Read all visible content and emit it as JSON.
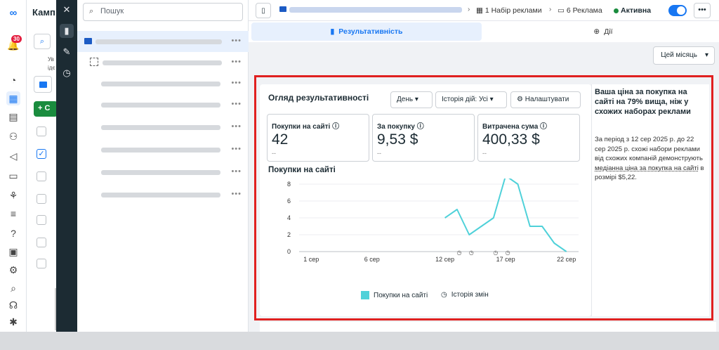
{
  "sidebar": {
    "notification_count": "30",
    "icons": [
      "meta-logo-icon",
      "notifications-icon",
      "dashboard-icon",
      "table-icon",
      "pages-icon",
      "audience-icon",
      "megaphone-icon",
      "billing-icon",
      "network-icon",
      "menu-icon",
      "help-icon",
      "news-icon",
      "settings-icon",
      "search-icon",
      "support-icon",
      "bug-icon"
    ]
  },
  "campaign_panel": {
    "title": "Камп",
    "create_label": "+ С",
    "truncated_text_1": "Ув",
    "truncated_text_2": "ідє"
  },
  "tree": {
    "search_placeholder": "Пошук",
    "row_menu": "•••"
  },
  "topbar": {
    "adset_crumb": "1 Набір реклами",
    "ad_crumb": "6 Реклама",
    "status": "Активна",
    "more": "•••"
  },
  "tabs": {
    "performance": "Результативність",
    "actions": "Дії"
  },
  "filters": {
    "period": "Цей місяць"
  },
  "overview": {
    "title": "Огляд результативності",
    "day_button": "День",
    "history_button": "Історія дій: Усі",
    "settings_button": "Налаштувати",
    "metrics": [
      {
        "label": "Покупки на сайті",
        "value": "42",
        "delta": "--"
      },
      {
        "label": "За покупку",
        "value": "9,53 $",
        "delta": "--"
      },
      {
        "label": "Витрачена сума",
        "value": "400,33 $",
        "delta": "--"
      }
    ],
    "chart_title": "Покупки на сайті"
  },
  "chart_data": {
    "type": "line",
    "title": "Покупки на сайті",
    "x_tick_labels": [
      "1 сер",
      "6 сер",
      "12 сер",
      "17 сер",
      "22 сер"
    ],
    "x_tick_days": [
      1,
      6,
      12,
      17,
      22
    ],
    "ylim": [
      0,
      8
    ],
    "yticks": [
      0,
      2,
      4,
      6,
      8
    ],
    "series": [
      {
        "name": "Покупки на сайті",
        "color": "#4fd1d9",
        "x": [
          12,
          13,
          14,
          15,
          16,
          17,
          18,
          19,
          20,
          21,
          22
        ],
        "y": [
          4,
          5,
          2,
          3,
          4,
          9,
          8,
          3,
          3,
          1,
          0
        ]
      }
    ],
    "change_history_days": [
      13,
      14,
      16,
      17
    ],
    "legend": [
      "Покупки на сайті",
      "Історія змін"
    ],
    "grid": true
  },
  "insight": {
    "heading": "Ваша ціна за покупка на сайті на 79% вища, ніж у схожих наборах реклами",
    "body_1": "За період з 12 сер 2025 р. до 22 сер 2025 р. схожі набори реклами від схожих компаній демонструють ",
    "body_link": "медіанна ціна за покупка на сайті",
    "body_2": " в розмірі $5,22."
  }
}
